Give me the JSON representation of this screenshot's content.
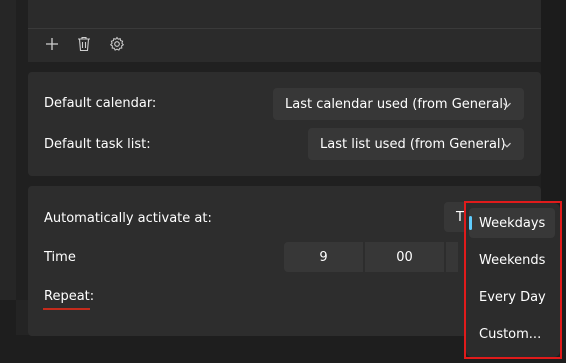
{
  "toolbar": {
    "add_icon": "plus-icon",
    "delete_icon": "trash-icon",
    "settings_icon": "gear-icon"
  },
  "defaults": {
    "calendar_label": "Default calendar:",
    "calendar_value": "Last calendar used (from General)",
    "task_list_label": "Default task list:",
    "task_list_value": "Last list used (from General)"
  },
  "schedule": {
    "activate_label": "Automatically activate at:",
    "activate_value_partial": "T",
    "time_label": "Time",
    "hour": "9",
    "minute": "00",
    "repeat_label": "Repeat:"
  },
  "repeat_menu": {
    "options": [
      "Weekdays",
      "Weekends",
      "Every Day",
      "Custom..."
    ],
    "selected": "Weekdays"
  },
  "colors": {
    "accent": "#60cdff",
    "highlight": "#e01b1b",
    "underline": "#c42b1c"
  }
}
